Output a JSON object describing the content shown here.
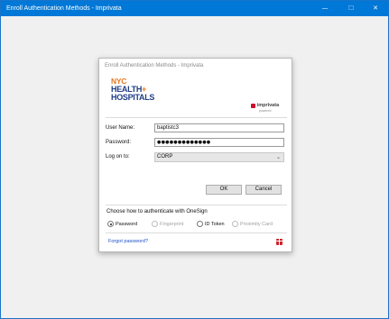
{
  "window": {
    "title": "Enroll Authentication Methods - Imprivata",
    "minimize_glyph": "—",
    "maximize_glyph": "☐",
    "close_glyph": "✕"
  },
  "dialog": {
    "title": "Enroll Authentication Methods - Imprivata",
    "logo": {
      "line1": "NYC",
      "line2": "HEALTH",
      "plus": "+",
      "line3": "HOSPITALS"
    },
    "imprivata": {
      "name": "imprivata",
      "sub": "powered"
    },
    "form": {
      "username_label": "User Name:",
      "username_value": "baptistc3",
      "password_label": "Password:",
      "password_value": "●●●●●●●●●●●●●",
      "logon_label": "Log on to:",
      "logon_value": "CORP",
      "chevron_icon": "chevron-down-icon"
    },
    "buttons": {
      "ok": "OK",
      "cancel": "Cancel"
    },
    "auth_section": {
      "heading": "Choose how to authenticate with OneSign",
      "options": [
        "Password",
        "Fingerprint",
        "ID Token",
        "Proximity Card"
      ],
      "selected": "Password"
    },
    "forgot_password": "Forgot password?",
    "colors": {
      "titlebar": "#0078d7",
      "accent_link": "#1a4fc7",
      "imprivata_red": "#c8102e",
      "nyc_blue": "#1f3c87",
      "nyc_orange": "#e87722"
    }
  }
}
